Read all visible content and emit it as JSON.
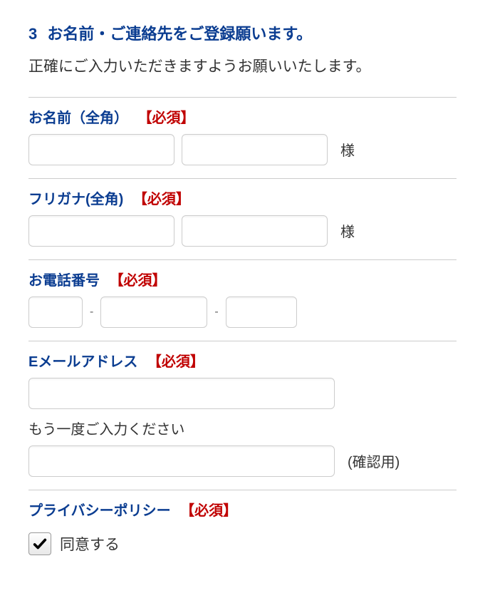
{
  "header": {
    "number": "3",
    "title": "お名前・ご連絡先をご登録願います。",
    "subtext": "正確にご入力いただきますようお願いいたします。"
  },
  "sections": {
    "name": {
      "label": "お名前（全角）",
      "required": "【必須】",
      "suffix": "様"
    },
    "furigana": {
      "label": "フリガナ(全角)",
      "required": "【必須】",
      "suffix": "様"
    },
    "phone": {
      "label": "お電話番号",
      "required": "【必須】",
      "sep": "-"
    },
    "email": {
      "label": "Eメールアドレス",
      "required": "【必須】",
      "hint": "もう一度ご入力ください",
      "confirm_suffix": "(確認用)"
    },
    "privacy": {
      "label": "プライバシーポリシー",
      "required": "【必須】",
      "checkbox_label": "同意する",
      "checked": true
    }
  }
}
